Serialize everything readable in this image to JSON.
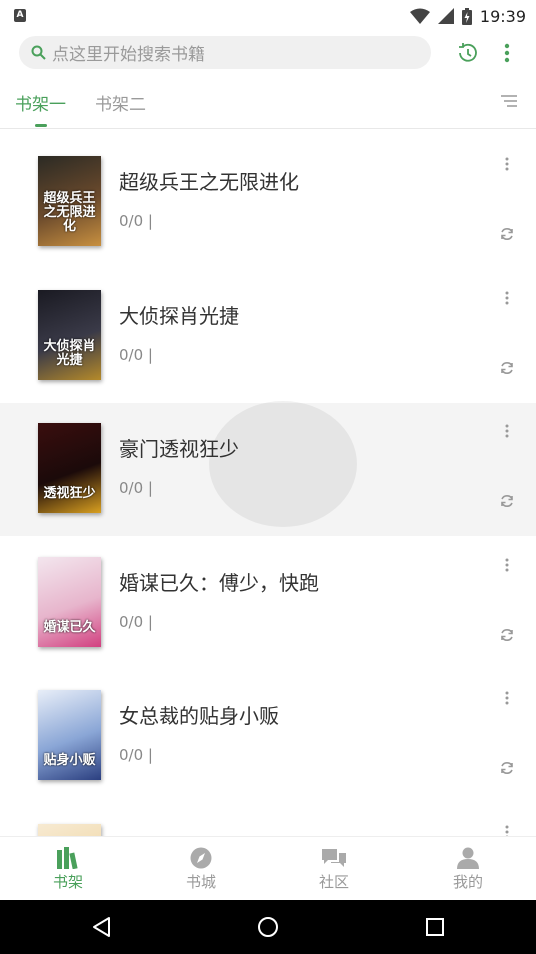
{
  "status_bar": {
    "left_icon": "A",
    "icons": [
      "wifi-icon",
      "signal-icon",
      "battery-icon"
    ],
    "time": "19:39"
  },
  "search": {
    "placeholder": "点这里开始搜索书籍",
    "icon": "search-icon"
  },
  "header_actions": {
    "history_icon": "history-icon",
    "more_icon": "more-vertical-icon"
  },
  "tabs": [
    {
      "label": "书架一",
      "active": true
    },
    {
      "label": "书架二",
      "active": false
    }
  ],
  "books": [
    {
      "title": "超级兵王之无限进化",
      "progress": "0/0 |",
      "cover_text": "超级兵王之无限进化",
      "cover_colors": [
        "#2b2a24",
        "#6b4a2c",
        "#c89040"
      ]
    },
    {
      "title": "大侦探肖光捷",
      "progress": "0/0 |",
      "cover_text": "大侦探肖光捷",
      "cover_colors": [
        "#1a1a22",
        "#3a3a48",
        "#b58a2a"
      ]
    },
    {
      "title": "豪门透视狂少",
      "progress": "0/0 |",
      "cover_text": "透视狂少",
      "cover_colors": [
        "#3a0e0e",
        "#1b0a0a",
        "#d9a020"
      ]
    },
    {
      "title": "婚谋已久：傅少，快跑",
      "progress": "0/0 |",
      "cover_text": "婚谋已久",
      "cover_colors": [
        "#f3e6ee",
        "#e7b5cc",
        "#d24080"
      ]
    },
    {
      "title": "女总裁的贴身小贩",
      "progress": "0/0 |",
      "cover_text": "贴身小贩",
      "cover_colors": [
        "#e8eef8",
        "#8aa6d6",
        "#2b3f80"
      ]
    },
    {
      "title": "",
      "progress": "",
      "cover_text": "",
      "cover_colors": [
        "#f7ead2",
        "#f0d8a8",
        "#c89a50"
      ]
    }
  ],
  "bottom_nav": [
    {
      "label": "书架",
      "icon": "bookshelf-icon",
      "active": true
    },
    {
      "label": "书城",
      "icon": "compass-icon",
      "active": false
    },
    {
      "label": "社区",
      "icon": "chat-icon",
      "active": false
    },
    {
      "label": "我的",
      "icon": "person-icon",
      "active": false
    }
  ],
  "colors": {
    "accent": "#4aa05b",
    "inactive": "#9a9a9a",
    "pressed_row": "#f4f4f4"
  }
}
